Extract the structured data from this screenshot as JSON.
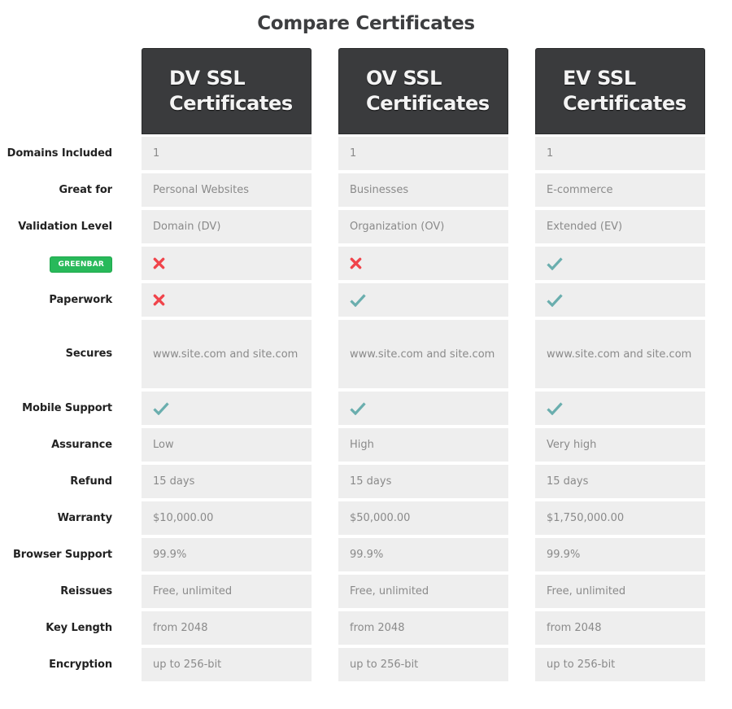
{
  "title": "Compare Certificates",
  "colors": {
    "header_bg": "#3a3b3d",
    "cell_bg": "#eeeeee",
    "check": "#6aaeae",
    "cross": "#f0444b",
    "badge": "#28b95a"
  },
  "columns": [
    {
      "line1": "DV SSL",
      "line2": "Certificates"
    },
    {
      "line1": "OV SSL",
      "line2": "Certificates"
    },
    {
      "line1": "EV SSL",
      "line2": "Certificates"
    }
  ],
  "rows": [
    {
      "label": "Domains Included",
      "type": "text",
      "values": [
        "1",
        "1",
        "1"
      ]
    },
    {
      "label": "Great for",
      "type": "text",
      "values": [
        "Personal Websites",
        "Businesses",
        "E-commerce"
      ]
    },
    {
      "label": "Validation Level",
      "type": "text",
      "values": [
        "Domain (DV)",
        "Organization (OV)",
        "Extended (EV)"
      ]
    },
    {
      "label": "GREENBAR",
      "label_style": "badge",
      "type": "icon",
      "values": [
        "cross-icon",
        "cross-icon",
        "check-icon"
      ]
    },
    {
      "label": "Paperwork",
      "type": "icon",
      "values": [
        "cross-icon",
        "check-icon",
        "check-icon"
      ]
    },
    {
      "label": "Secures",
      "type": "text",
      "tall": true,
      "values": [
        "www.site.com and site.com",
        "www.site.com and site.com",
        "www.site.com and site.com"
      ]
    },
    {
      "label": "Mobile Support",
      "type": "icon",
      "values": [
        "check-icon",
        "check-icon",
        "check-icon"
      ]
    },
    {
      "label": "Assurance",
      "type": "text",
      "values": [
        "Low",
        "High",
        "Very high"
      ]
    },
    {
      "label": "Refund",
      "type": "text",
      "values": [
        "15 days",
        "15 days",
        "15 days"
      ]
    },
    {
      "label": "Warranty",
      "type": "text",
      "values": [
        "$10,000.00",
        "$50,000.00",
        "$1,750,000.00"
      ]
    },
    {
      "label": "Browser Support",
      "type": "text",
      "values": [
        "99.9%",
        "99.9%",
        "99.9%"
      ]
    },
    {
      "label": "Reissues",
      "type": "text",
      "values": [
        "Free, unlimited",
        "Free, unlimited",
        "Free, unlimited"
      ]
    },
    {
      "label": "Key Length",
      "type": "text",
      "values": [
        "from 2048",
        "from 2048",
        "from 2048"
      ]
    },
    {
      "label": "Encryption",
      "type": "text",
      "values": [
        "up to 256-bit",
        "up to 256-bit",
        "up to 256-bit"
      ]
    }
  ]
}
